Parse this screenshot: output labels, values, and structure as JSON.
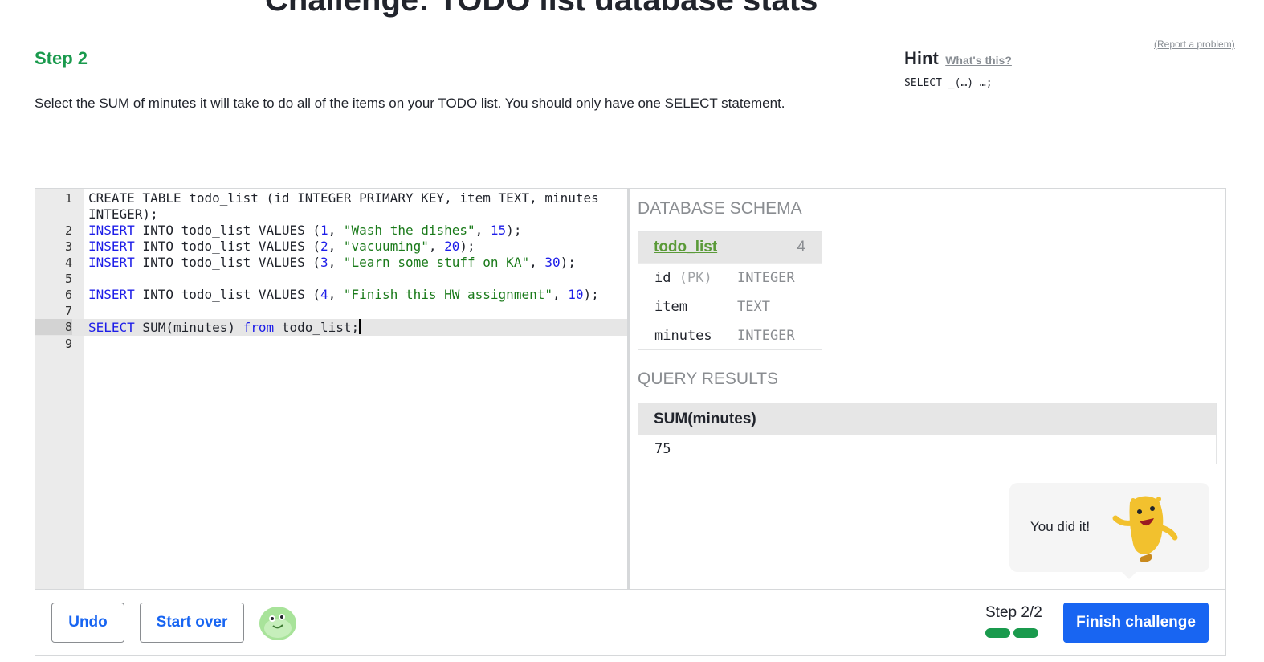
{
  "page": {
    "title": "Challenge: TODO list database stats",
    "report_link": "(Report a problem)",
    "step_title": "Step 2",
    "instructions": "Select the SUM of minutes it will take to do all of the items on your TODO list. You should only have one SELECT statement."
  },
  "hint": {
    "label": "Hint",
    "link": "What's this?",
    "code": "SELECT _(…) …;"
  },
  "editor": {
    "active_line": 8,
    "lines": [
      {
        "n": "1",
        "tokens": [
          [
            "",
            "CREATE TABLE todo_list (id INTEGER PRIMARY KEY, item TEXT, minutes INTEGER);"
          ]
        ]
      },
      {
        "n": "2",
        "tokens": [
          [
            "kw",
            "INSERT"
          ],
          [
            "",
            " INTO todo_list VALUES ("
          ],
          [
            "num",
            "1"
          ],
          [
            "",
            ", "
          ],
          [
            "str",
            "\"Wash the dishes\""
          ],
          [
            "",
            ", "
          ],
          [
            "num",
            "15"
          ],
          [
            "",
            ");"
          ]
        ]
      },
      {
        "n": "3",
        "tokens": [
          [
            "kw",
            "INSERT"
          ],
          [
            "",
            " INTO todo_list VALUES ("
          ],
          [
            "num",
            "2"
          ],
          [
            "",
            ", "
          ],
          [
            "str",
            "\"vacuuming\""
          ],
          [
            "",
            ", "
          ],
          [
            "num",
            "20"
          ],
          [
            "",
            ");"
          ]
        ]
      },
      {
        "n": "4",
        "tokens": [
          [
            "kw",
            "INSERT"
          ],
          [
            "",
            " INTO todo_list VALUES ("
          ],
          [
            "num",
            "3"
          ],
          [
            "",
            ", "
          ],
          [
            "str",
            "\"Learn some stuff on KA\""
          ],
          [
            "",
            ", "
          ],
          [
            "num",
            "30"
          ],
          [
            "",
            ");"
          ]
        ]
      },
      {
        "n": "5",
        "tokens": []
      },
      {
        "n": "6",
        "tokens": [
          [
            "kw",
            "INSERT"
          ],
          [
            "",
            " INTO todo_list VALUES ("
          ],
          [
            "num",
            "4"
          ],
          [
            "",
            ", "
          ],
          [
            "str",
            "\"Finish this HW assignment\""
          ],
          [
            "",
            ", "
          ],
          [
            "num",
            "10"
          ],
          [
            "",
            ");"
          ]
        ]
      },
      {
        "n": "7",
        "tokens": []
      },
      {
        "n": "8",
        "tokens": [
          [
            "kw",
            "SELECT"
          ],
          [
            "",
            " SUM(minutes) "
          ],
          [
            "kw",
            "from"
          ],
          [
            "",
            " todo_list;"
          ]
        ]
      },
      {
        "n": "9",
        "tokens": []
      }
    ]
  },
  "schema": {
    "label": "DATABASE SCHEMA",
    "table_name": "todo_list",
    "row_count": "4",
    "columns": [
      {
        "name": "id",
        "pk": "(PK)",
        "type": "INTEGER"
      },
      {
        "name": "item",
        "pk": "",
        "type": "TEXT"
      },
      {
        "name": "minutes",
        "pk": "",
        "type": "INTEGER"
      }
    ]
  },
  "results": {
    "label": "QUERY RESULTS",
    "header": "SUM(minutes)",
    "value": "75"
  },
  "message": {
    "text": "You did it!"
  },
  "footer": {
    "undo_label": "Undo",
    "start_over_label": "Start over",
    "step_counter": "Step 2/2",
    "steps_completed": 2,
    "steps_total": 2,
    "finish_label": "Finish challenge"
  },
  "colors": {
    "accent_blue": "#1865f2",
    "step_green": "#1a9a4d",
    "schema_link_green": "#5a9a38",
    "mascot_yellow": "#f2c12e",
    "avatar_green": "#a8e39a"
  }
}
